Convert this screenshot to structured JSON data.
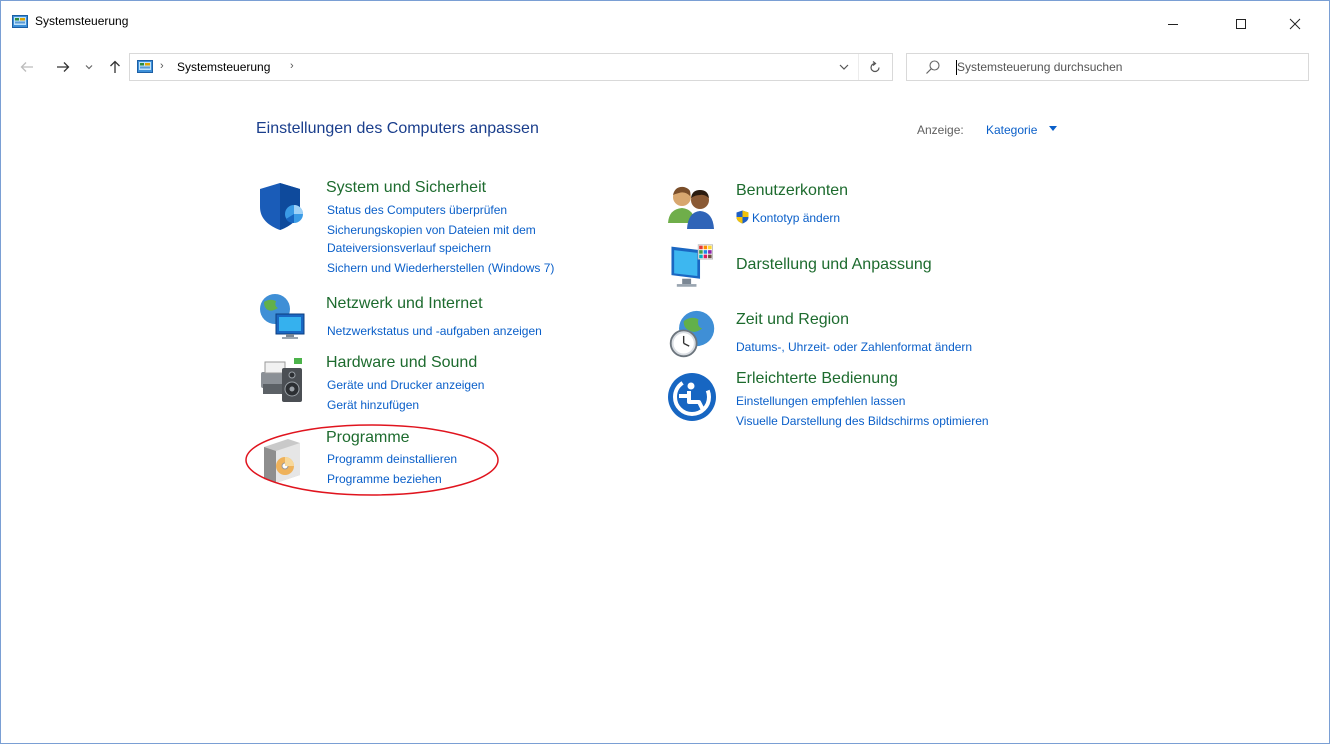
{
  "window": {
    "title": "Systemsteuerung",
    "min_icon": "minimize-icon",
    "max_icon": "maximize-icon",
    "close_icon": "close-icon"
  },
  "address": {
    "crumbs": [
      "Systemsteuerung"
    ],
    "search_placeholder": "Systemsteuerung durchsuchen"
  },
  "main": {
    "heading": "Einstellungen des Computers anpassen",
    "view_label": "Anzeige:",
    "view_value": "Kategorie"
  },
  "left_categories": [
    {
      "title": "System und Sicherheit",
      "icon": "shield-icon",
      "links": [
        "Status des Computers überprüfen",
        "Sicherungskopien von Dateien mit dem",
        "Dateiversionsverlauf speichern",
        "Sichern und Wiederherstellen (Windows 7)"
      ]
    },
    {
      "title": "Netzwerk und Internet",
      "icon": "network-globe-icon",
      "links": [
        "Netzwerkstatus und -aufgaben anzeigen"
      ]
    },
    {
      "title": "Hardware und Sound",
      "icon": "printer-speaker-icon",
      "links": [
        "Geräte und Drucker anzeigen",
        "Gerät hinzufügen"
      ]
    },
    {
      "title": "Programme",
      "icon": "programs-disc-icon",
      "links": [
        "Programm deinstallieren",
        "Programme beziehen"
      ]
    }
  ],
  "right_categories": [
    {
      "title": "Benutzerkonten",
      "icon": "users-icon",
      "links": [
        "Kontotyp ändern"
      ]
    },
    {
      "title": "Darstellung und Anpassung",
      "icon": "monitor-palette-icon",
      "links": []
    },
    {
      "title": "Zeit und Region",
      "icon": "clock-globe-icon",
      "links": [
        "Datums-, Uhrzeit- oder Zahlenformat ändern"
      ]
    },
    {
      "title": "Erleichterte Bedienung",
      "icon": "ease-of-access-icon",
      "links": [
        "Einstellungen empfehlen lassen",
        "Visuelle Darstellung des Bildschirms optimieren"
      ]
    }
  ],
  "colors": {
    "category_title": "#1d6b2e",
    "link": "#0a5fc9",
    "heading": "#1a3e8c",
    "annotation": "#e0141e"
  }
}
